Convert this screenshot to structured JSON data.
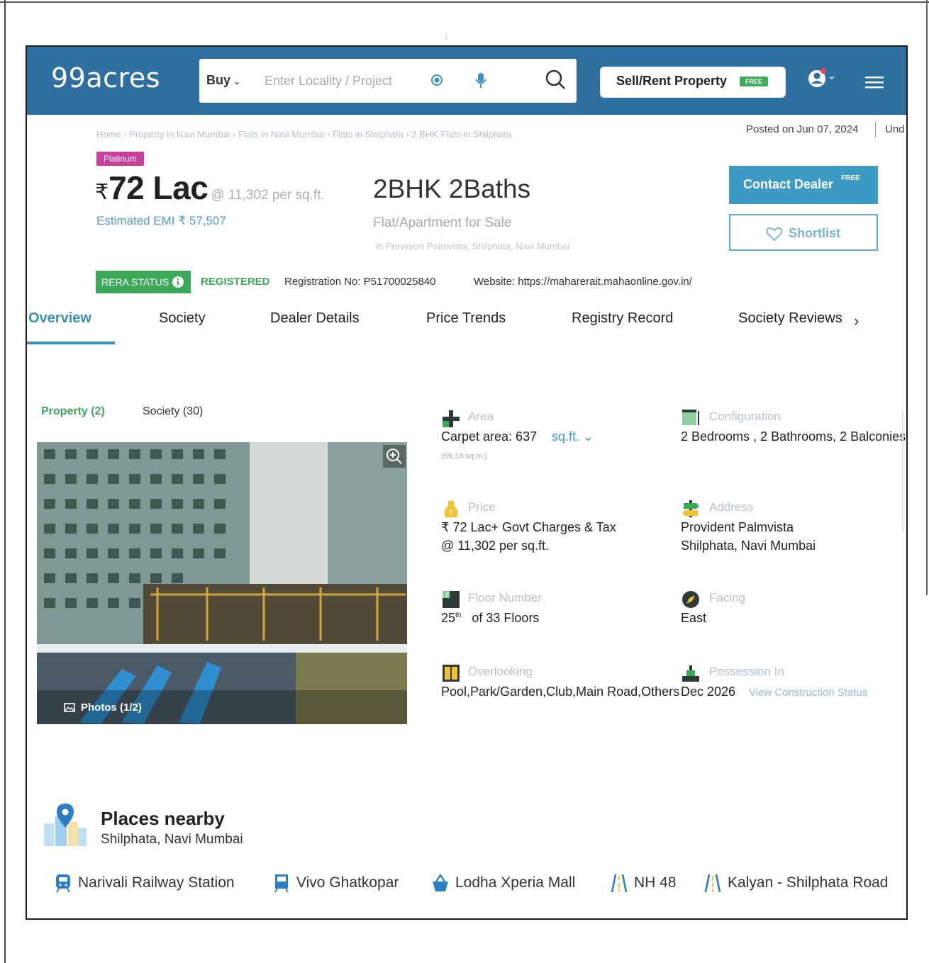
{
  "header": {
    "logo": "99acres",
    "search": {
      "mode": "Buy",
      "placeholder": "Enter Locality / Project"
    },
    "sell_rent_label": "Sell/Rent Property",
    "sell_rent_badge": "FREE",
    "brand_color": "#2f6fa0"
  },
  "breadcrumb": "Home › Property in Navi Mumbai › Flats in Navi Mumbai › Flats in Shilphata › 2 BHK Flats in Shilphata",
  "posted": "Posted on Jun 07, 2024",
  "posted_cut": "Und",
  "listing": {
    "tier_badge": "Platinum",
    "currency": "₹",
    "price": "72 Lac",
    "price_per_sqft": "@ 11,302 per sq.ft.",
    "emi": "Estimated EMI ₹ 57,507",
    "title": "2BHK 2Baths",
    "subtitle": "Flat/Apartment for Sale",
    "location_line": "in Provident Palmvista, Shilphata, Navi Mumbai"
  },
  "actions": {
    "contact_label": "Contact Dealer",
    "contact_badge": "FREE",
    "shortlist_label": "Shortlist"
  },
  "rera": {
    "badge": "RERA STATUS",
    "status": "REGISTERED",
    "registration": "Registration No: P51700025840",
    "website": "Website: https://maharerait.mahaonline.gov.in/"
  },
  "tabs": [
    "Overview",
    "Society",
    "Dealer Details",
    "Price Trends",
    "Registry Record",
    "Society Reviews"
  ],
  "gallery": {
    "tabs": [
      "Property (2)",
      "Society (30)"
    ],
    "photos_label": "Photos (1/2)"
  },
  "details": {
    "area": {
      "label": "Area",
      "value": "Carpet area: 637",
      "unit": "sq.ft.",
      "sub": "(59.18 sq.m.)"
    },
    "configuration": {
      "label": "Configuration",
      "value": "2 Bedrooms , 2 Bathrooms, 2 Balconies"
    },
    "price": {
      "label": "Price",
      "line1": "₹ 72 Lac+ Govt Charges & Tax",
      "line2": "@ 11,302 per sq.ft."
    },
    "address": {
      "label": "Address",
      "line1": "Provident Palmvista",
      "line2": "Shilphata, Navi Mumbai"
    },
    "floor": {
      "label": "Floor Number",
      "floor": "25",
      "suffix": "th",
      "of": "of 33 Floors"
    },
    "facing": {
      "label": "Facing",
      "value": "East"
    },
    "overlooking": {
      "label": "Overlooking",
      "value": "Pool,Park/Garden,Club,Main Road,Others"
    },
    "possession": {
      "label": "Possession In",
      "value": "Dec 2026",
      "link": "View Construction Status"
    }
  },
  "places": {
    "title": "Places nearby",
    "subtitle": "Shilphata, Navi Mumbai",
    "items": [
      {
        "label": "Narivali Railway Station",
        "icon": "train-icon"
      },
      {
        "label": "Vivo Ghatkopar",
        "icon": "metro-icon"
      },
      {
        "label": "Lodha Xperia Mall",
        "icon": "shopping-basket-icon"
      },
      {
        "label": "NH 48",
        "icon": "road-icon"
      },
      {
        "label": "Kalyan - Shilphata Road",
        "icon": "road-icon"
      }
    ]
  }
}
